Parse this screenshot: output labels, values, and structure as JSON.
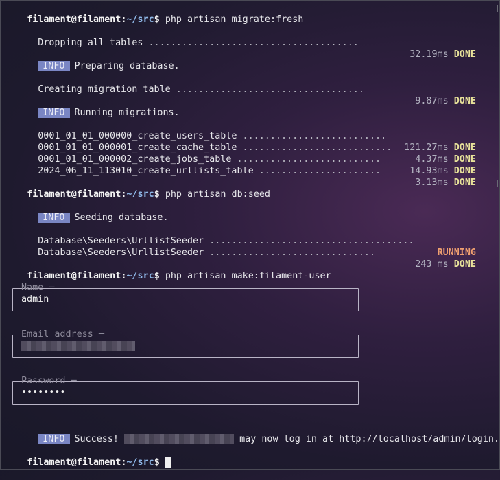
{
  "prompt": {
    "user": "filament@filament",
    "sep": ":",
    "path": "~/src",
    "sign": "$"
  },
  "commands": {
    "migrate": "php artisan migrate:fresh",
    "seed": "php artisan db:seed",
    "make_user": "php artisan make:filament-user"
  },
  "migrate": {
    "drop": {
      "label": "Dropping all tables",
      "time": "32.19ms",
      "status": "DONE"
    },
    "info1": {
      "badge": "INFO",
      "text": "Preparing database."
    },
    "create_table": {
      "label": "Creating migration table",
      "time": "9.87ms",
      "status": "DONE"
    },
    "info2": {
      "badge": "INFO",
      "text": "Running migrations."
    },
    "migrations": [
      {
        "name": "0001_01_01_000000_create_users_table",
        "time": "121.27ms",
        "status": "DONE"
      },
      {
        "name": "0001_01_01_000001_create_cache_table",
        "time": "4.37ms",
        "status": "DONE"
      },
      {
        "name": "0001_01_01_000002_create_jobs_table",
        "time": "14.93ms",
        "status": "DONE"
      },
      {
        "name": "2024_06_11_113010_create_urllists_table",
        "time": "3.13ms",
        "status": "DONE"
      }
    ]
  },
  "seed": {
    "info": {
      "badge": "INFO",
      "text": "Seeding database."
    },
    "rows": [
      {
        "name": "Database\\Seeders\\UrllistSeeder",
        "time": "",
        "status": "RUNNING"
      },
      {
        "name": "Database\\Seeders\\UrllistSeeder",
        "time": "243 ms",
        "status": "DONE"
      }
    ]
  },
  "make_user": {
    "name_label": "Name",
    "name_value": "admin",
    "email_label": "Email address",
    "password_label": "Password",
    "password_value": "••••••••",
    "success": {
      "badge": "INFO",
      "prefix": "Success!",
      "suffix": "may now log in at http://localhost/admin/login."
    }
  }
}
